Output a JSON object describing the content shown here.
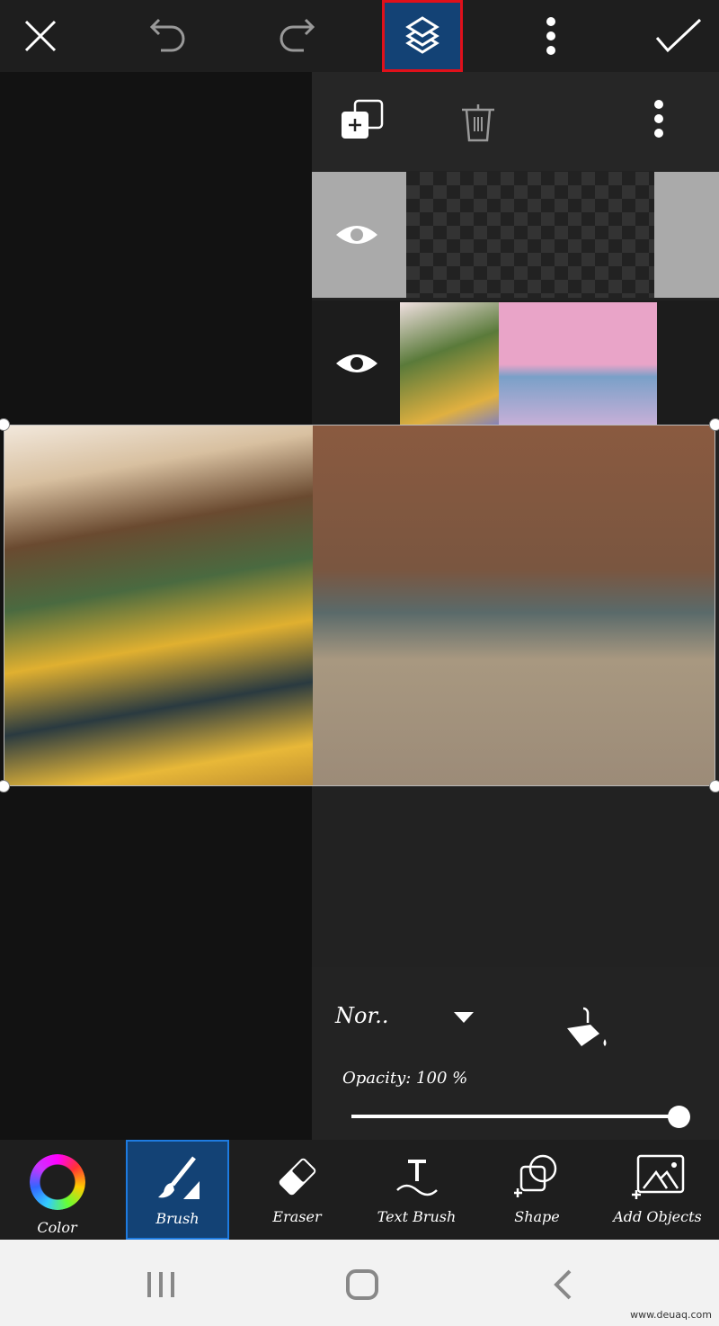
{
  "toolbar_top": {
    "icons": [
      "close-icon",
      "undo-icon",
      "redo-icon",
      "layers-icon",
      "more-vertical-icon",
      "check-icon"
    ],
    "active": "layers",
    "accent": "#134275",
    "highlight": "#e0101a"
  },
  "layers_panel": {
    "icons": [
      "add-layer-icon",
      "trash-icon",
      "more-vertical-icon"
    ],
    "layers": [
      {
        "visible": true,
        "type": "transparent",
        "selected": true
      },
      {
        "visible": true,
        "type": "image"
      }
    ]
  },
  "blend": {
    "mode": "Nor..",
    "opacity_label": "Opacity: 100 %",
    "opacity": 100
  },
  "tools": [
    {
      "label": "Color"
    },
    {
      "label": "Brush",
      "active": true
    },
    {
      "label": "Eraser"
    },
    {
      "label": "Text Brush"
    },
    {
      "label": "Shape"
    },
    {
      "label": "Add Objects"
    }
  ],
  "watermark": "www.deuaq.com"
}
